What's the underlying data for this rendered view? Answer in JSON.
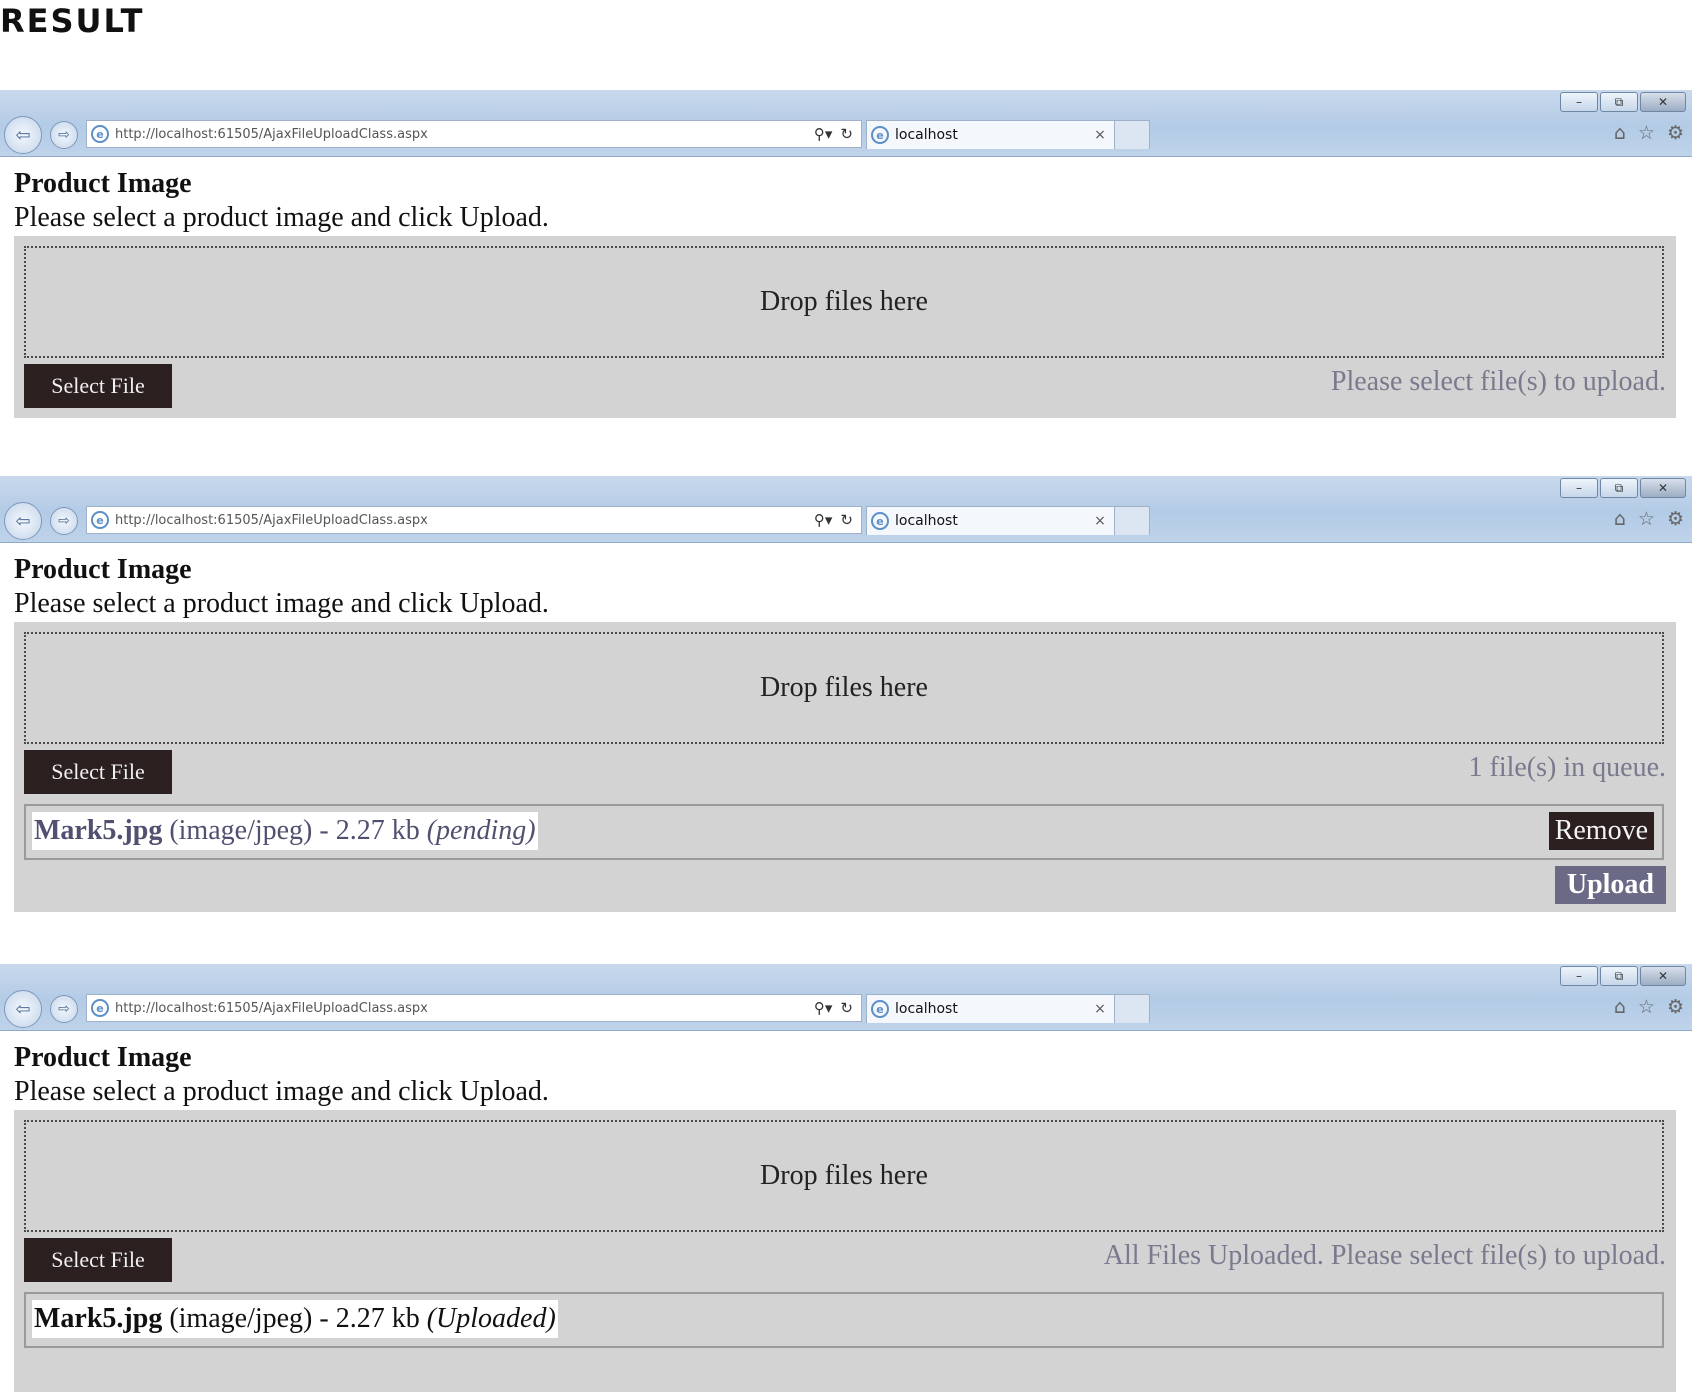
{
  "heading": "RESULT",
  "browser": {
    "url": "http://localhost:61505/AjaxFileUploadClass.aspx",
    "tab_title": "localhost",
    "tab_close": "×",
    "minimize": "–",
    "restore": "⧉",
    "close": "✕",
    "back": "⇦",
    "forward": "⇨",
    "search_glyph": "⚲▾",
    "refresh_glyph": "↻",
    "home_glyph": "⌂",
    "favorites_glyph": "☆",
    "tools_glyph": "⚙"
  },
  "shots": [
    {
      "title": "Product Image",
      "instruction": "Please select a product image and click Upload.",
      "drop_text": "Drop files here",
      "select_label": "Select File",
      "status": "Please select file(s) to upload."
    },
    {
      "title": "Product Image",
      "instruction": "Please select a product image and click Upload.",
      "drop_text": "Drop files here",
      "select_label": "Select File",
      "status": "1 file(s) in queue.",
      "file": {
        "name": "Mark5.jpg",
        "meta": " (image/jpeg) - 2.27 kb ",
        "state": "(pending)"
      },
      "remove_label": "Remove",
      "upload_label": "Upload"
    },
    {
      "title": "Product Image",
      "instruction": "Please select a product image and click Upload.",
      "drop_text": "Drop files here",
      "select_label": "Select File",
      "status": "All Files Uploaded. Please select file(s) to upload.",
      "file": {
        "name": "Mark5.jpg",
        "meta": " (image/jpeg) - 2.27 kb ",
        "state": "(Uploaded)"
      }
    }
  ]
}
